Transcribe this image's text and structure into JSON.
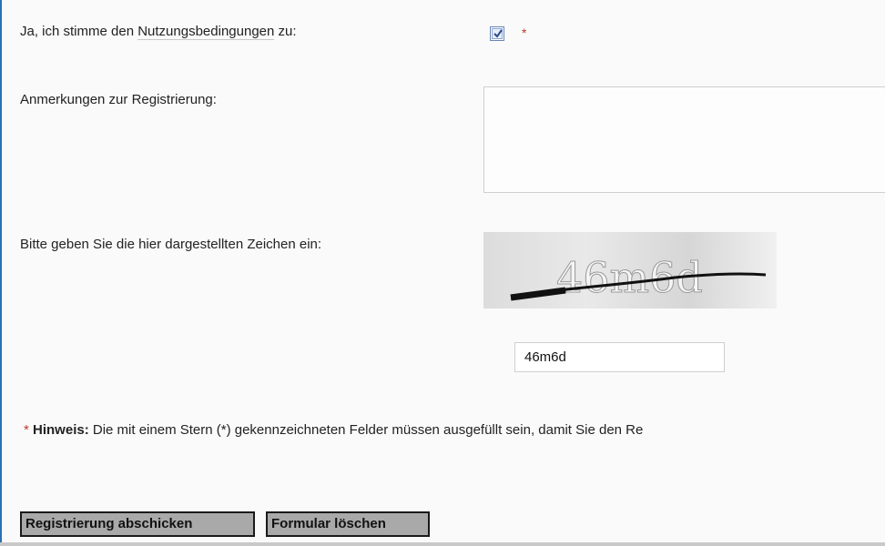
{
  "terms": {
    "prefix": "Ja, ich stimme den ",
    "link": "Nutzungsbedingungen",
    "suffix": " zu:",
    "checked": true,
    "required_marker": "*"
  },
  "remarks": {
    "label": "Anmerkungen zur Registrierung:",
    "value": ""
  },
  "captcha": {
    "label": "Bitte geben Sie die hier dargestellten Zeichen ein:",
    "image_text": "46m6d",
    "input_value": "46m6d"
  },
  "note": {
    "star": "*",
    "bold": "Hinweis:",
    "text": " Die mit einem Stern (*) gekennzeichneten Felder müssen ausgefüllt sein, damit Sie den Re"
  },
  "buttons": {
    "submit": "Registrierung abschicken",
    "reset": "Formular löschen"
  },
  "colors": {
    "accent_border": "#2d6fb5",
    "required": "#c0392b",
    "button_bg": "#a9a9a9"
  }
}
